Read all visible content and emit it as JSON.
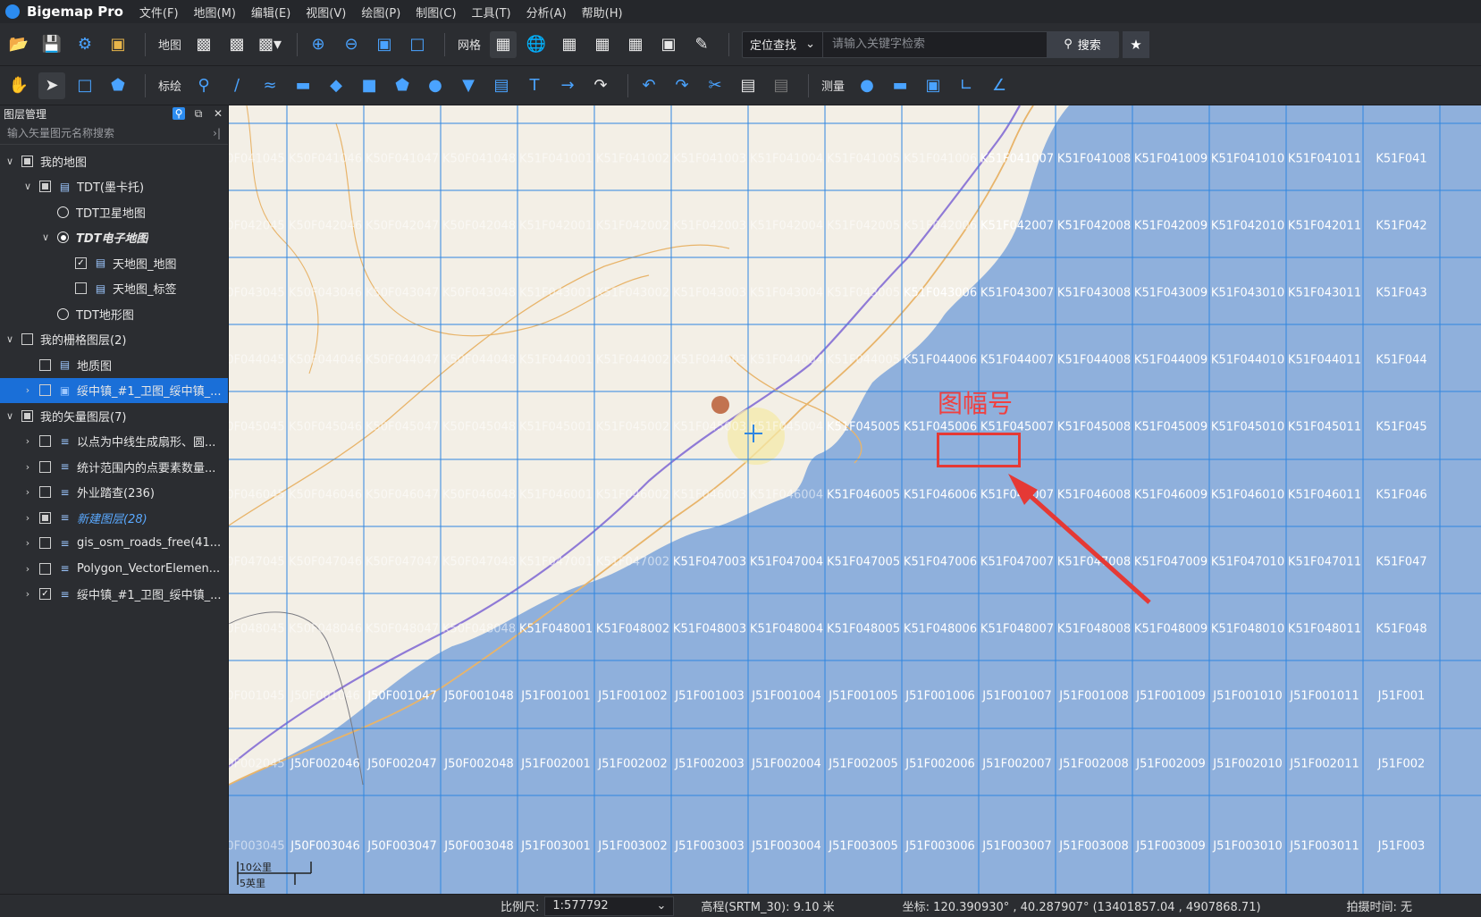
{
  "app": {
    "name": "Bigemap Pro"
  },
  "menu": [
    "文件(F)",
    "地图(M)",
    "编辑(E)",
    "视图(V)",
    "绘图(P)",
    "制图(C)",
    "工具(T)",
    "分析(A)",
    "帮助(H)"
  ],
  "toolbar1": {
    "map_label": "地图",
    "grid_label": "网格",
    "search_type": "定位查找",
    "search_placeholder": "请输入关键字检索",
    "search_button": "搜索"
  },
  "toolbar2": {
    "draw_label": "标绘",
    "measure_label": "测量"
  },
  "panel": {
    "title": "图层管理",
    "filter_placeholder": "输入矢量图元名称搜索",
    "items": [
      {
        "label": "我的地图",
        "level": 0,
        "caret": "v",
        "control": "part",
        "icon": ""
      },
      {
        "label": "TDT(墨卡托)",
        "level": 1,
        "caret": "v",
        "control": "part",
        "icon": "map"
      },
      {
        "label": "TDT卫星地图",
        "level": 2,
        "caret": "",
        "control": "radio",
        "icon": ""
      },
      {
        "label": "TDT电子地图",
        "level": 2,
        "caret": "v",
        "control": "radio-on",
        "icon": "",
        "style": "italic"
      },
      {
        "label": "天地图_地图",
        "level": 3,
        "caret": "",
        "control": "checked",
        "icon": "map"
      },
      {
        "label": "天地图_标签",
        "level": 3,
        "caret": "",
        "control": "empty",
        "icon": "map"
      },
      {
        "label": "TDT地形图",
        "level": 2,
        "caret": "",
        "control": "radio",
        "icon": ""
      },
      {
        "label": "我的栅格图层(2)",
        "level": 0,
        "caret": "v",
        "control": "empty",
        "icon": ""
      },
      {
        "label": "地质图",
        "level": 1,
        "caret": "",
        "control": "empty",
        "icon": "map"
      },
      {
        "label": "绥中镇_#1_卫图_绥中镇_...",
        "level": 1,
        "caret": ">",
        "control": "empty",
        "icon": "img",
        "style": "selected"
      },
      {
        "label": "我的矢量图层(7)",
        "level": 0,
        "caret": "v",
        "control": "part",
        "icon": ""
      },
      {
        "label": "以点为中线生成扇形、圆...",
        "level": 1,
        "caret": ">",
        "control": "empty",
        "icon": "layers"
      },
      {
        "label": "统计范围内的点要素数量...",
        "level": 1,
        "caret": ">",
        "control": "empty",
        "icon": "layers"
      },
      {
        "label": "外业踏查(236)",
        "level": 1,
        "caret": ">",
        "control": "empty",
        "icon": "layers"
      },
      {
        "label": "新建图层(28)",
        "level": 1,
        "caret": ">",
        "control": "part",
        "icon": "layers",
        "style": "bluetext"
      },
      {
        "label": "gis_osm_roads_free(41...",
        "level": 1,
        "caret": ">",
        "control": "empty",
        "icon": "layers"
      },
      {
        "label": "Polygon_VectorElemen...",
        "level": 1,
        "caret": ">",
        "control": "empty",
        "icon": "layers"
      },
      {
        "label": "绥中镇_#1_卫图_绥中镇_...",
        "level": 1,
        "caret": ">",
        "control": "checked",
        "icon": "layers"
      }
    ]
  },
  "map": {
    "annotation": "图幅号",
    "scale_top": "10公里",
    "scale_bottom": "5英里",
    "rows": [
      [
        "0F041045",
        "K50F041046",
        "K50F041047",
        "K50F041048",
        "K51F041001",
        "K51F041002",
        "K51F041003",
        "K51F041004",
        "K51F041005",
        "K51F041006",
        "K51F041007",
        "K51F041008",
        "K51F041009",
        "K51F041010",
        "K51F041011",
        "K51F041"
      ],
      [
        "0F042045",
        "K50F042046",
        "K50F042047",
        "K50F042048",
        "K51F042001",
        "K51F042002",
        "K51F042003",
        "K51F042004",
        "K51F042005",
        "K51F042006",
        "K51F042007",
        "K51F042008",
        "K51F042009",
        "K51F042010",
        "K51F042011",
        "K51F042"
      ],
      [
        "0F043045",
        "K50F043046",
        "K50F043047",
        "K50F043048",
        "K51F043001",
        "K51F043002",
        "K51F043003",
        "K51F043004",
        "K51F043005",
        "K51F043006",
        "K51F043007",
        "K51F043008",
        "K51F043009",
        "K51F043010",
        "K51F043011",
        "K51F043"
      ],
      [
        "0F044045",
        "K50F044046",
        "K50F044047",
        "K50F044048",
        "K51F044001",
        "K51F044002",
        "K51F044003",
        "K51F044004",
        "K51F044005",
        "K51F044006",
        "K51F044007",
        "K51F044008",
        "K51F044009",
        "K51F044010",
        "K51F044011",
        "K51F044"
      ],
      [
        "0F045045",
        "K50F045046",
        "K50F045047",
        "K50F045048",
        "K51F045001",
        "K51F045002",
        "K51F045003",
        "K51F045004",
        "K51F045005",
        "K51F045006",
        "K51F045007",
        "K51F045008",
        "K51F045009",
        "K51F045010",
        "K51F045011",
        "K51F045"
      ],
      [
        "0F046045",
        "K50F046046",
        "K50F046047",
        "K50F046048",
        "K51F046001",
        "K51F046002",
        "K51F046003",
        "K51F046004",
        "K51F046005",
        "K51F046006",
        "K51F046007",
        "K51F046008",
        "K51F046009",
        "K51F046010",
        "K51F046011",
        "K51F046"
      ],
      [
        "0F047045",
        "K50F047046",
        "K50F047047",
        "K50F047048",
        "K51F047001",
        "K51F047002",
        "K51F047003",
        "K51F047004",
        "K51F047005",
        "K51F047006",
        "K51F047007",
        "K51F047008",
        "K51F047009",
        "K51F047010",
        "K51F047011",
        "K51F047"
      ],
      [
        "0F048045",
        "K50F048046",
        "K50F048047",
        "K50F048048",
        "K51F048001",
        "K51F048002",
        "K51F048003",
        "K51F048004",
        "K51F048005",
        "K51F048006",
        "K51F048007",
        "K51F048008",
        "K51F048009",
        "K51F048010",
        "K51F048011",
        "K51F048"
      ],
      [
        "0F001045",
        "J50F001046",
        "J50F001047",
        "J50F001048",
        "J51F001001",
        "J51F001002",
        "J51F001003",
        "J51F001004",
        "J51F001005",
        "J51F001006",
        "J51F001007",
        "J51F001008",
        "J51F001009",
        "J51F001010",
        "J51F001011",
        "J51F001"
      ],
      [
        "0F002045",
        "J50F002046",
        "J50F002047",
        "J50F002048",
        "J51F002001",
        "J51F002002",
        "J51F002003",
        "J51F002004",
        "J51F002005",
        "J51F002006",
        "J51F002007",
        "J51F002008",
        "J51F002009",
        "J51F002010",
        "J51F002011",
        "J51F002"
      ],
      [
        "0F003045",
        "J50F003046",
        "J50F003047",
        "J50F003048",
        "J51F003001",
        "J51F003002",
        "J51F003003",
        "J51F003004",
        "J51F003005",
        "J51F003006",
        "J51F003007",
        "J51F003008",
        "J51F003009",
        "J51F003010",
        "J51F003011",
        "J51F003"
      ]
    ]
  },
  "status": {
    "scale_label": "比例尺:",
    "scale_value": "1:577792",
    "elevation": "高程(SRTM_30): 9.10 米",
    "coords": "坐标: 120.390930° , 40.287907°  (13401857.04 , 4907868.71)",
    "capture_time": "拍摄时间: 无"
  },
  "colors": {
    "accent": "#1a6fd8",
    "sea": "#8fb0dc",
    "land": "#f3efe6",
    "grid": "#2f86e0",
    "annotation": "#e53935"
  }
}
